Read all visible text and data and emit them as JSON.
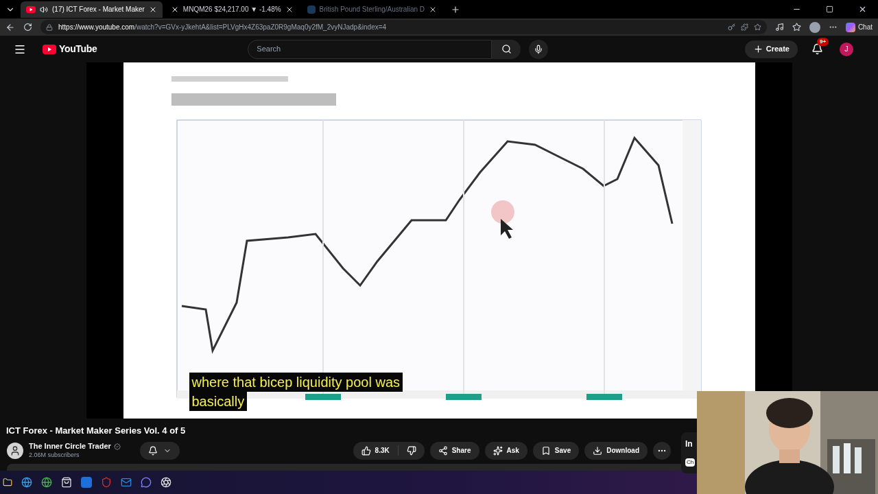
{
  "browser": {
    "tabs": [
      {
        "label": "(17) ICT Forex - Market Maker",
        "selected": true,
        "kind": "video"
      },
      {
        "label": "MNQM26 $24,217.00 ▼ -1.48%",
        "selected": false,
        "kind": "x"
      },
      {
        "label": "British Pound Sterling/Australian D",
        "selected": false,
        "kind": "bing"
      }
    ],
    "url_host": "https://www.youtube.com",
    "url_path": "/watch?v=GVx-yJkehtA&list=PLVgHx4Z63paZ0R9gMaq0y2fM_2vyNJadp&index=4",
    "chat": "Chat"
  },
  "header": {
    "logo": "YouTube",
    "search": {
      "placeholder": "Search"
    },
    "create": "Create",
    "notifications": "9+",
    "avatar": "J"
  },
  "player": {
    "kind": "picture",
    "captions": [
      "where that bicep liquidity pool was",
      "basically"
    ]
  },
  "video": {
    "title": "ICT Forex - Market Maker Series Vol. 4 of 5",
    "channel": "The Inner Circle Trader",
    "subscribers": "2.06M subscribers",
    "likes": "8.3K",
    "actions": [
      "Share",
      "Ask",
      "Save",
      "Download"
    ]
  },
  "side_panel": {
    "heading": "In",
    "chip": "Ch"
  }
}
